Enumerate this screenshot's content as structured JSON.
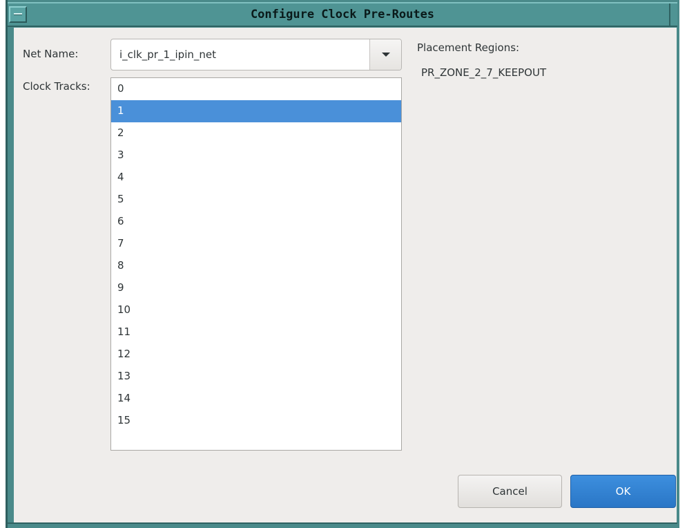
{
  "window": {
    "title": "Configure Clock Pre-Routes"
  },
  "form": {
    "net_name_label": "Net Name:",
    "net_name_value": "i_clk_pr_1_ipin_net",
    "clock_tracks_label": "Clock Tracks:",
    "clock_tracks": [
      "0",
      "1",
      "2",
      "3",
      "4",
      "5",
      "6",
      "7",
      "8",
      "9",
      "10",
      "11",
      "12",
      "13",
      "14",
      "15"
    ],
    "selected_track": "1",
    "placement_regions_label": "Placement Regions:",
    "placement_region_value": "PR_ZONE_2_7_KEEPOUT"
  },
  "buttons": {
    "cancel": "Cancel",
    "ok": "OK"
  },
  "icons": {
    "window_menu": "window-menu-icon",
    "dropdown": "chevron-down-icon"
  },
  "colors": {
    "titlebar": "#4f9494",
    "selection": "#4a90d9",
    "ok_button": "#2f80d1",
    "dialog_bg": "#efedeb"
  }
}
